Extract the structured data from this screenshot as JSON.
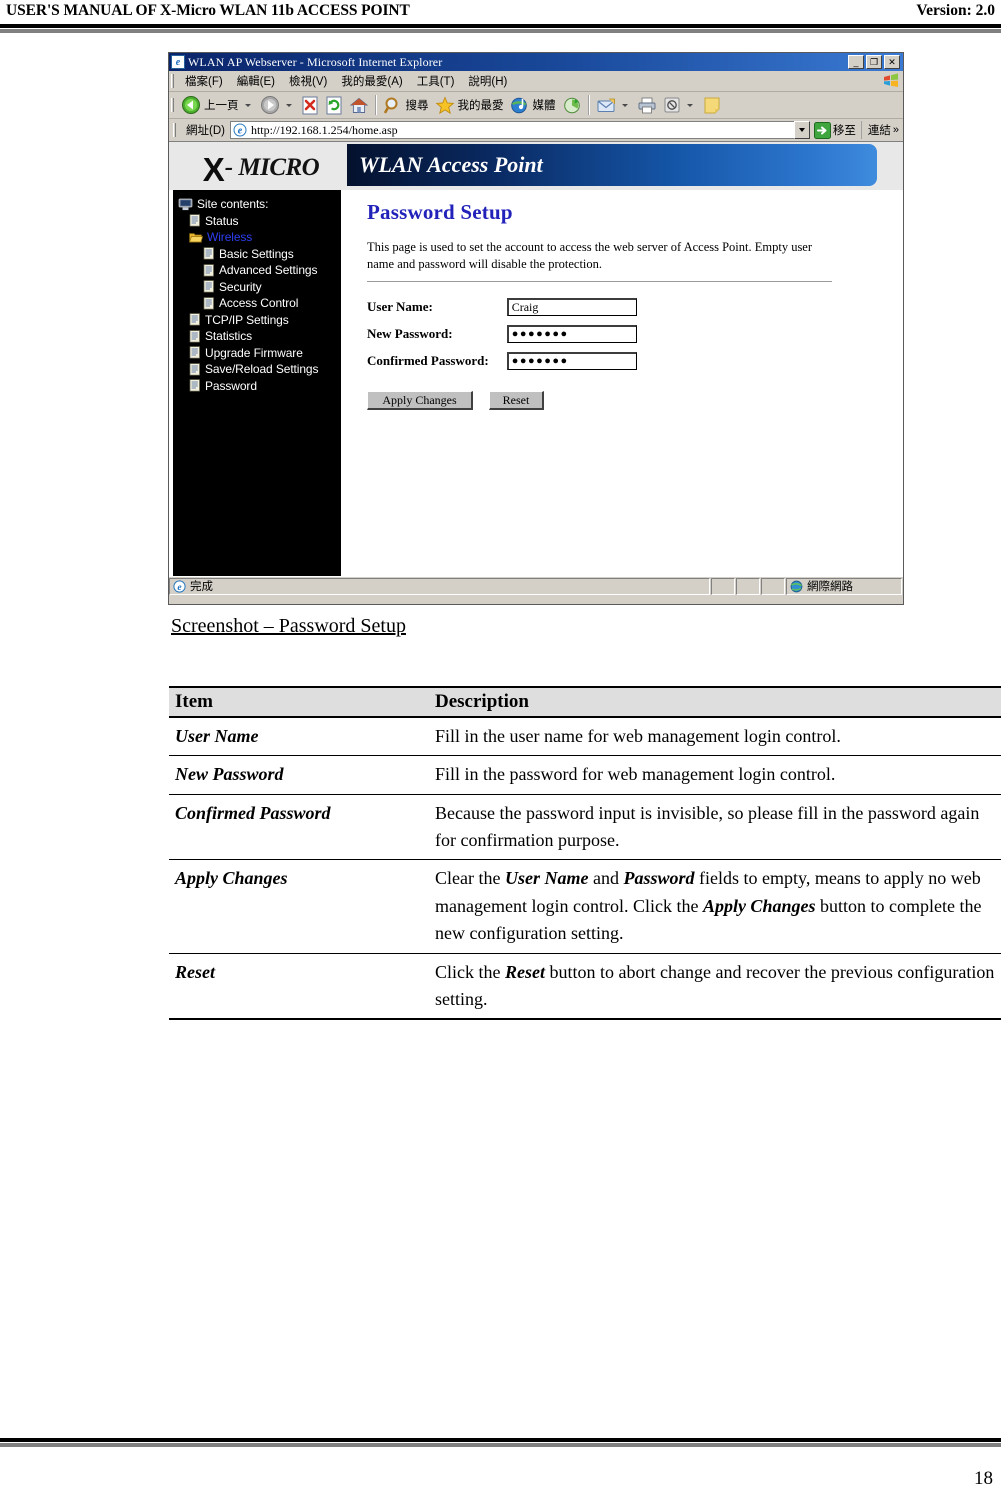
{
  "document": {
    "header_title": "USER'S MANUAL OF X-Micro WLAN 11b ACCESS POINT",
    "version": "Version: 2.0",
    "caption": "Screenshot – Password Setup",
    "page_number": "18"
  },
  "browser": {
    "window_title": "WLAN AP Webserver - Microsoft Internet Explorer",
    "window_buttons": {
      "minimize": "_",
      "restore": "❐",
      "close": "✕"
    },
    "menu": [
      "檔案(F)",
      "編輯(E)",
      "檢視(V)",
      "我的最愛(A)",
      "工具(T)",
      "說明(H)"
    ],
    "toolbar": {
      "back_label": "上一頁",
      "search_label": "搜尋",
      "favorites_label": "我的最愛",
      "media_label": "媒體"
    },
    "address": {
      "label": "網址(D)",
      "url": "http://192.168.1.254/home.asp",
      "go_label": "移至",
      "links_label": "連結",
      "chevrons": "»"
    },
    "status": {
      "text": "完成",
      "zone": "網際網路"
    }
  },
  "webpage": {
    "brand": {
      "x": "X",
      "name": "- MICRO"
    },
    "banner_title": "WLAN Access Point",
    "sidebar": {
      "root": "Site contents:",
      "items": [
        {
          "label": "Status",
          "level": 1,
          "icon": "page-icon",
          "active": false
        },
        {
          "label": "Wireless",
          "level": 1,
          "icon": "folder-open-icon",
          "active": true
        },
        {
          "label": "Basic Settings",
          "level": 2,
          "icon": "page-icon",
          "active": false
        },
        {
          "label": "Advanced Settings",
          "level": 2,
          "icon": "page-icon",
          "active": false
        },
        {
          "label": "Security",
          "level": 2,
          "icon": "page-icon",
          "active": false
        },
        {
          "label": "Access Control",
          "level": 2,
          "icon": "page-icon",
          "active": false
        },
        {
          "label": "TCP/IP Settings",
          "level": 1,
          "icon": "page-icon",
          "active": false
        },
        {
          "label": "Statistics",
          "level": 1,
          "icon": "page-icon",
          "active": false
        },
        {
          "label": "Upgrade Firmware",
          "level": 1,
          "icon": "page-icon",
          "active": false
        },
        {
          "label": "Save/Reload Settings",
          "level": 1,
          "icon": "page-icon",
          "active": false
        },
        {
          "label": "Password",
          "level": 1,
          "icon": "page-icon",
          "active": false
        }
      ]
    },
    "page_title": "Password Setup",
    "page_description": "This page is used to set the account to access the web server of Access Point. Empty user name and password will disable the protection.",
    "form": {
      "user_name_label": "User Name:",
      "user_name_value": "Craig",
      "new_password_label": "New Password:",
      "new_password_value": "●●●●●●●",
      "confirmed_password_label": "Confirmed Password:",
      "confirmed_password_value": "●●●●●●●",
      "apply_label": "Apply Changes",
      "reset_label": "Reset"
    }
  },
  "table": {
    "headers": {
      "item": "Item",
      "description": "Description"
    },
    "rows": [
      {
        "item": "User Name",
        "description": "Fill in the user name for web management login control."
      },
      {
        "item": "New Password",
        "description": "Fill in the password for web management login control."
      },
      {
        "item": "Confirmed Password",
        "description": "Because the password input is invisible, so please fill in the password again for confirmation purpose."
      },
      {
        "item": "Apply Changes",
        "description": "Clear the User Name and Password fields to empty, means to apply no web management login control. Click the Apply Changes button to complete the new configuration setting.",
        "emphasis": [
          "User Name",
          "Password",
          "Apply Changes"
        ]
      },
      {
        "item": "Reset",
        "description": "Click the Reset button to abort change and recover the previous configuration setting.",
        "emphasis": [
          "Reset"
        ]
      }
    ]
  },
  "colors": {
    "title_bar": "#0a246a",
    "banner_gradient_start": "#04112e",
    "banner_gradient_end": "#3f8bdd",
    "page_title": "#2222bb",
    "sidebar_bg": "#000000",
    "sidebar_active": "#2e3ff0",
    "chrome": "#d4d0c8"
  }
}
